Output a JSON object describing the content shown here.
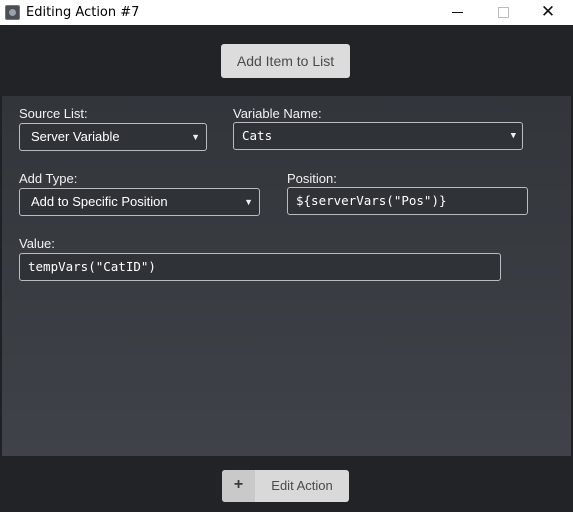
{
  "window": {
    "title": "Editing Action #7",
    "minimize_icon": "minimize-icon",
    "maximize_icon": "maximize-icon",
    "close_icon": "close-icon",
    "close_glyph": "✕"
  },
  "toolbar": {
    "add_item_label": "Add Item to List"
  },
  "form": {
    "source_list": {
      "label": "Source List:",
      "value": "Server Variable"
    },
    "variable_name": {
      "label": "Variable Name:",
      "value": "Cats"
    },
    "add_type": {
      "label": "Add Type:",
      "value": "Add to Specific Position"
    },
    "position": {
      "label": "Position:",
      "value": "${serverVars(\"Pos\")}"
    },
    "value": {
      "label": "Value:",
      "value": "tempVars(\"CatID\")"
    },
    "dropdown_caret": "▼"
  },
  "footer": {
    "edit_action_label": "Edit Action",
    "plus_glyph": "+"
  },
  "colors": {
    "titlebar_bg": "#ffffff",
    "toolbar_bg": "#212326",
    "panel_bg": "#3b3f44",
    "button_bg": "#dcdcdc",
    "field_border": "#b9bcc0"
  }
}
